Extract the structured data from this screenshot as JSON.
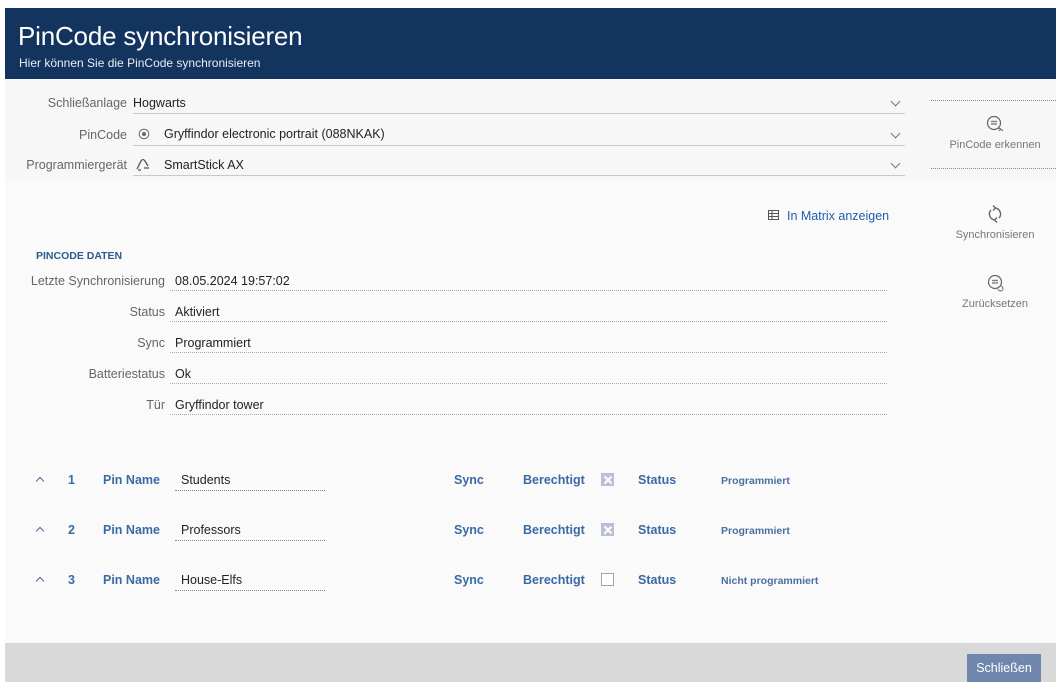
{
  "header": {
    "title": "PinCode synchronisieren",
    "subtitle": "Hier können Sie die PinCode synchronisieren"
  },
  "selectors": {
    "schliessanlage": {
      "label": "Schließanlage",
      "value": "Hogwarts"
    },
    "pincode": {
      "label": "PinCode",
      "value": "Gryffindor electronic portrait (088NKAK)",
      "icon": "pincode-radio-icon"
    },
    "programmiergeraet": {
      "label": "Programmiergerät",
      "value": "SmartStick AX",
      "icon": "smartstick-icon"
    }
  },
  "sidebar": {
    "pincode_erkennen": "PinCode erkennen",
    "synchronisieren": "Synchronisieren",
    "zuruecksetzen": "Zurücksetzen"
  },
  "matrix_link": "In Matrix anzeigen",
  "pincode_daten": {
    "title": "PINCODE DATEN",
    "fields": [
      {
        "label": "Letzte Synchronisierung",
        "value": "08.05.2024 19:57:02"
      },
      {
        "label": "Status",
        "value": "Aktiviert"
      },
      {
        "label": "Sync",
        "value": "Programmiert"
      },
      {
        "label": "Batteriestatus",
        "value": "Ok"
      },
      {
        "label": "Tür",
        "value": "Gryffindor tower"
      }
    ]
  },
  "pins": {
    "labels": {
      "pin_name": "Pin Name",
      "sync": "Sync",
      "berechtigt": "Berechtigt",
      "status": "Status"
    },
    "rows": [
      {
        "num": "1",
        "name": "Students",
        "berechtigt": true,
        "status": "Programmiert"
      },
      {
        "num": "2",
        "name": "Professors",
        "berechtigt": true,
        "status": "Programmiert"
      },
      {
        "num": "3",
        "name": "House-Elfs",
        "berechtigt": false,
        "status": "Nicht programmiert"
      }
    ]
  },
  "footer": {
    "close_label": "Schließen"
  },
  "colors": {
    "header_bg": "#12345f",
    "accent": "#3a6aa5",
    "close_button": "#6f87ad"
  }
}
